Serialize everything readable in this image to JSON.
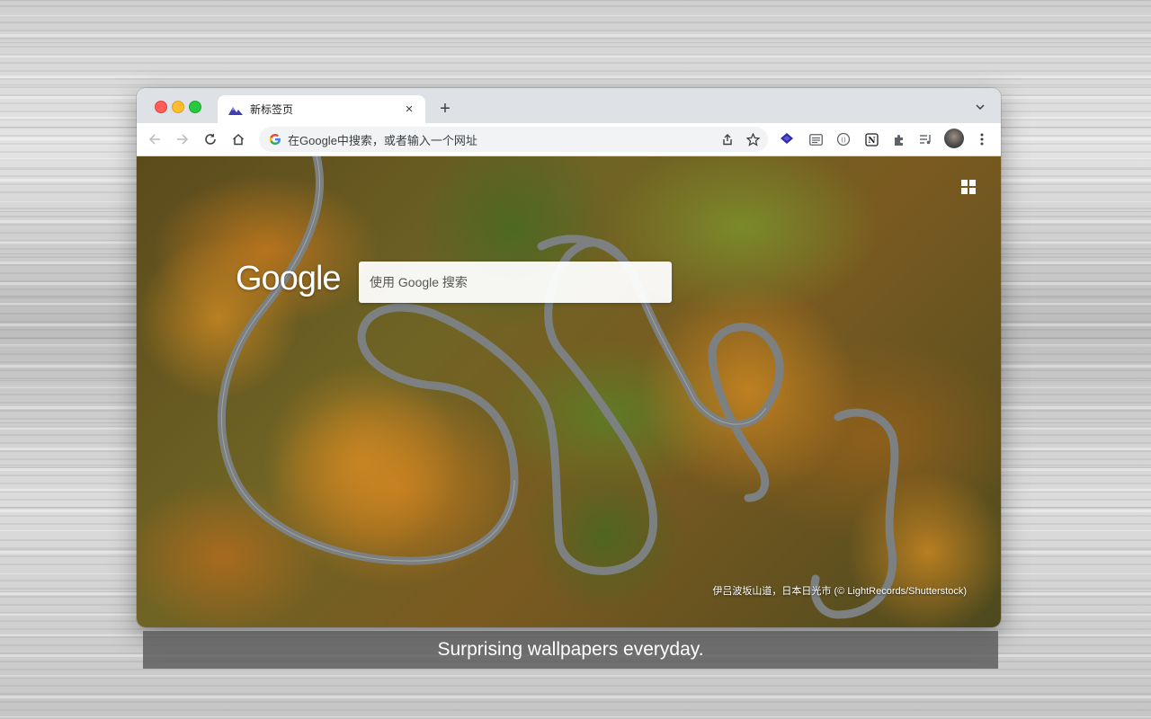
{
  "browser": {
    "tab_title": "新标签页",
    "new_tab_symbol": "+",
    "close_symbol": "×",
    "omnibox_text": "在Google中搜索，或者输入一个网址"
  },
  "newtab_page": {
    "logo_text": "Google",
    "search_placeholder": "使用 Google 搜索",
    "photo_credit": "伊吕波坂山道，日本日光市 (© LightRecords/Shutterstock)"
  },
  "caption": "Surprising wallpapers everyday.",
  "icons": {
    "tab_favicon": "mountain-icon",
    "back": "arrow-left-icon",
    "forward": "arrow-right-icon",
    "reload": "reload-icon",
    "home": "home-icon",
    "omnibox_google": "google-g-icon",
    "share": "share-icon",
    "bookmark": "star-icon",
    "extensions": [
      "layers-extension-icon",
      "reader-extension-icon",
      "vpn-extension-icon",
      "notion-icon",
      "puzzle-icon",
      "media-icon"
    ],
    "profile": "avatar",
    "menu": "more-vertical-icon",
    "apps": "apps-grid-icon"
  },
  "colors": {
    "titlebar": "#dee1e6",
    "toolbar": "#ffffff",
    "omnibox": "#f1f3f4",
    "traffic_red": "#ff5f57",
    "traffic_yellow": "#febc2e",
    "traffic_green": "#28c840",
    "caption_bar": "#5a5a5a"
  }
}
